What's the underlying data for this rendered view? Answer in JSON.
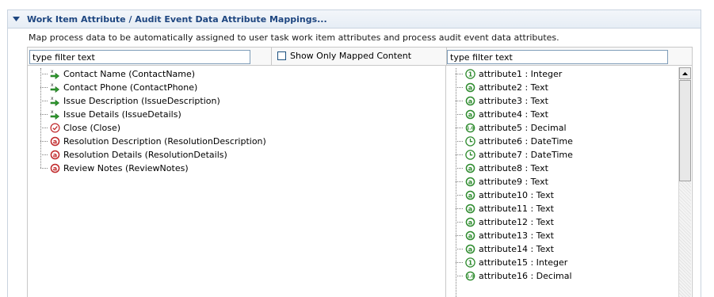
{
  "section": {
    "title": "Work Item Attribute / Audit Event Data Attribute Mappings...",
    "description": "Map process data to be automatically assigned to user task work item attributes and process audit event data attributes."
  },
  "filters": {
    "left_value": "type filter text",
    "right_value": "type filter text",
    "show_mapped_label": "Show Only Mapped Content",
    "show_mapped_checked": false
  },
  "process_data": [
    {
      "label": "Contact Name (ContactName)",
      "icon": "mapped-field-icon"
    },
    {
      "label": "Contact Phone (ContactPhone)",
      "icon": "mapped-field-icon"
    },
    {
      "label": "Issue Description (IssueDescription)",
      "icon": "mapped-field-icon"
    },
    {
      "label": "Issue Details (IssueDetails)",
      "icon": "mapped-field-icon"
    },
    {
      "label": "Close (Close)",
      "icon": "boolean-field-icon"
    },
    {
      "label": "Resolution Description (ResolutionDescription)",
      "icon": "text-field-icon"
    },
    {
      "label": "Resolution Details (ResolutionDetails)",
      "icon": "text-field-icon"
    },
    {
      "label": "Review Notes (ReviewNotes)",
      "icon": "text-field-icon"
    }
  ],
  "attributes": [
    {
      "label": "attribute1 : Integer",
      "icon": "integer-attr-icon"
    },
    {
      "label": "attribute2 : Text",
      "icon": "text-attr-icon"
    },
    {
      "label": "attribute3 : Text",
      "icon": "text-attr-icon"
    },
    {
      "label": "attribute4 : Text",
      "icon": "text-attr-icon"
    },
    {
      "label": "attribute5 : Decimal",
      "icon": "decimal-attr-icon"
    },
    {
      "label": "attribute6 : DateTime",
      "icon": "datetime-attr-icon"
    },
    {
      "label": "attribute7 : DateTime",
      "icon": "datetime-attr-icon"
    },
    {
      "label": "attribute8 : Text",
      "icon": "text-attr-icon"
    },
    {
      "label": "attribute9 : Text",
      "icon": "text-attr-icon"
    },
    {
      "label": "attribute10 : Text",
      "icon": "text-attr-icon"
    },
    {
      "label": "attribute11 : Text",
      "icon": "text-attr-icon"
    },
    {
      "label": "attribute12 : Text",
      "icon": "text-attr-icon"
    },
    {
      "label": "attribute13 : Text",
      "icon": "text-attr-icon"
    },
    {
      "label": "attribute14 : Text",
      "icon": "text-attr-icon"
    },
    {
      "label": "attribute15 : Integer",
      "icon": "integer-attr-icon"
    },
    {
      "label": "attribute16 : Decimal",
      "icon": "decimal-attr-icon"
    }
  ],
  "colors": {
    "title": "#1e4680",
    "attr_green": "#2e8b2e",
    "field_red": "#c0282a"
  }
}
